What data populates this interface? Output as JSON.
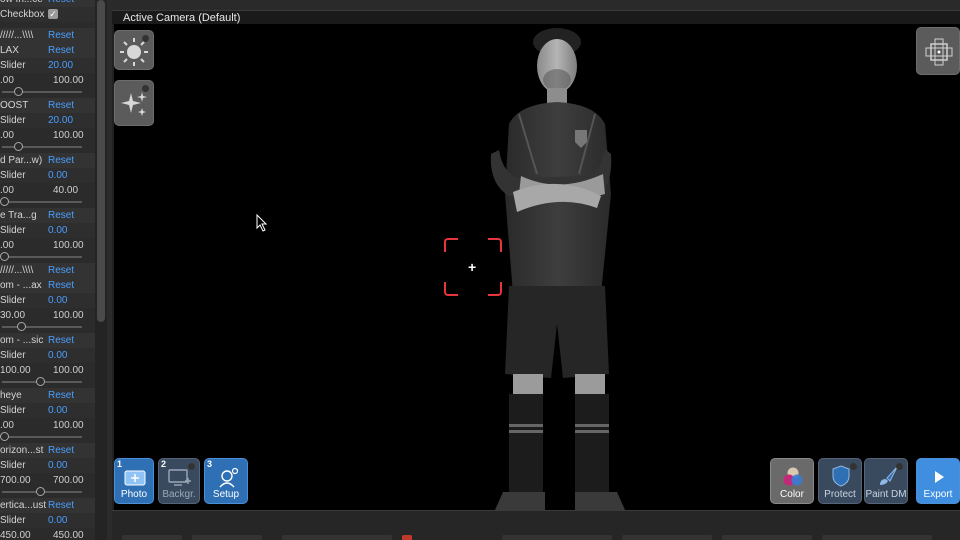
{
  "panel": {
    "sections": [
      {
        "title": "ow In...ce",
        "reset": "Reset",
        "control_label": "Checkbox",
        "checkbox_checked": true
      },
      {
        "title": "/////...\\\\\\\\",
        "reset": "Reset"
      },
      {
        "title": "LAX",
        "reset": "Reset",
        "control_label": "Slider",
        "value": "20.00",
        "min": ".00",
        "max": "100.00",
        "fraction": 0.2
      },
      {
        "title": "OOST",
        "reset": "Reset",
        "control_label": "Slider",
        "value": "20.00",
        "min": ".00",
        "max": "100.00",
        "fraction": 0.2
      },
      {
        "title": "d Par...w)",
        "reset": "Reset",
        "control_label": "Slider",
        "value": "0.00",
        "min": ".00",
        "max": "40.00",
        "fraction": 0.0
      },
      {
        "title": "e Tra...g",
        "reset": "Reset",
        "control_label": "Slider",
        "value": "0.00",
        "min": ".00",
        "max": "100.00",
        "fraction": 0.0
      },
      {
        "title": "/////...\\\\\\\\",
        "reset": "Reset"
      },
      {
        "title": "om - ...ax",
        "reset": "Reset",
        "control_label": "Slider",
        "value": "0.00",
        "min": "30.00",
        "max": "100.00",
        "fraction": 0.23
      },
      {
        "title": "om - ...sic",
        "reset": "Reset",
        "control_label": "Slider",
        "value": "0.00",
        "min": "100.00",
        "max": "100.00",
        "fraction": 0.5
      },
      {
        "title": "heye",
        "reset": "Reset",
        "control_label": "Slider",
        "value": "0.00",
        "min": ".00",
        "max": "100.00",
        "fraction": 0.0
      },
      {
        "title": "orizon...st",
        "reset": "Reset",
        "control_label": "Slider",
        "value": "0.00",
        "min": "700.00",
        "max": "700.00",
        "fraction": 0.5
      },
      {
        "title": "ertica...ust",
        "reset": "Reset",
        "control_label": "Slider",
        "value": "0.00",
        "min": "450.00",
        "max": "450.00",
        "fraction": 0.5
      }
    ]
  },
  "viewport": {
    "title": "Active Camera (Default)",
    "background_color": "#000000",
    "focus_box_color": "#e8343a"
  },
  "tools_left": [
    {
      "name": "sun-icon"
    },
    {
      "name": "sparkles-icon"
    }
  ],
  "tools_bottom_left": [
    {
      "number": "1",
      "label": "Photo",
      "icon": "photo-add-icon"
    },
    {
      "number": "2",
      "label": "Backgr.",
      "icon": "monitor-icon"
    },
    {
      "number": "3",
      "label": "Setup",
      "icon": "person-gear-icon"
    }
  ],
  "tools_bottom_right": [
    {
      "label": "Color",
      "icon": "color-circles-icon"
    },
    {
      "label": "Protect",
      "icon": "shield-icon"
    },
    {
      "label": "Paint DM",
      "icon": "brush-icon"
    },
    {
      "label": "Export",
      "icon": "play-icon"
    }
  ],
  "colors": {
    "accent": "#4a9eff",
    "tool_blue": "#2f6fb4",
    "focus_red": "#e8343a"
  }
}
